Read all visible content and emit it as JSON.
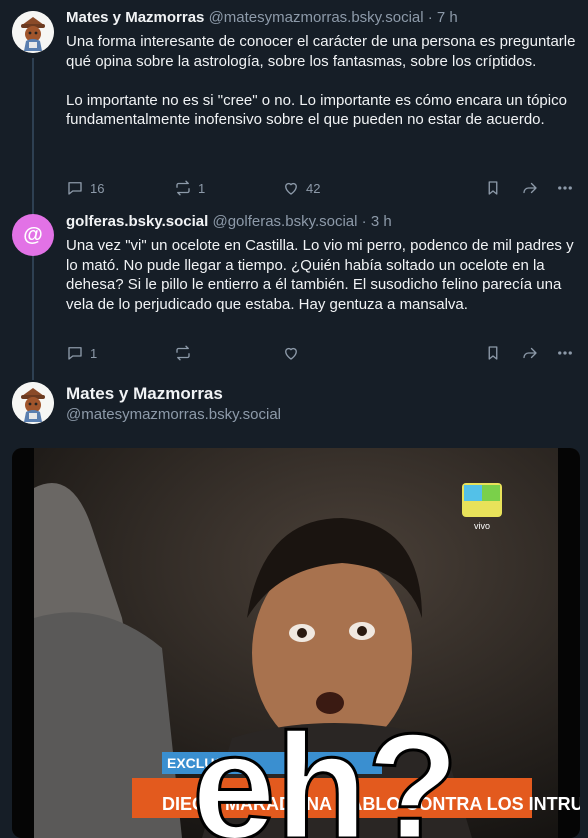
{
  "posts": [
    {
      "display_name": "Mates y Mazmorras",
      "handle": "@matesymazmorras.bsky.social",
      "time": "· 7 h",
      "text": "Una forma interesante de conocer el carácter de una persona es preguntarle qué opina sobre la astrología, sobre los fantasmas, sobre los críptidos.\n\nLo importante no es si \"cree\" o no. Lo importante es cómo encara un tópico fundamentalmente inofensivo sobre el que pueden no estar de acuerdo.",
      "replies": "16",
      "reposts": "1",
      "likes": "42"
    },
    {
      "display_name": "golferas.bsky.social",
      "handle": "@golferas.bsky.social",
      "time": "· 3 h",
      "avatar_glyph": "@",
      "text": "Una vez \"vi\" un ocelote en Castilla. Lo vio mi perro, podenco de mil padres y lo mató. No pude llegar a tiempo. ¿Quién había soltado un ocelote en la dehesa? Si le pillo le entierro a él también. El susodicho felino parecía una vela de lo perjudicado que estaba. Hay gentuza a mansalva.",
      "replies": "1",
      "reposts": "",
      "likes": ""
    }
  ],
  "main_post": {
    "display_name": "Mates y Mazmorras",
    "handle": "@matesymazmorras.bsky.social",
    "image": {
      "caption_big": "eh?",
      "banner_top": "EXCLUSIVO",
      "banner_text": "DIEGO MARADONA HABLO CONTRA LOS INTRUSOS",
      "channel_logo": "vivo"
    }
  },
  "colors": {
    "background": "#161e27",
    "text": "#f1f3f5",
    "muted": "#8d9aa9",
    "golf_avatar": "#e272e6"
  }
}
